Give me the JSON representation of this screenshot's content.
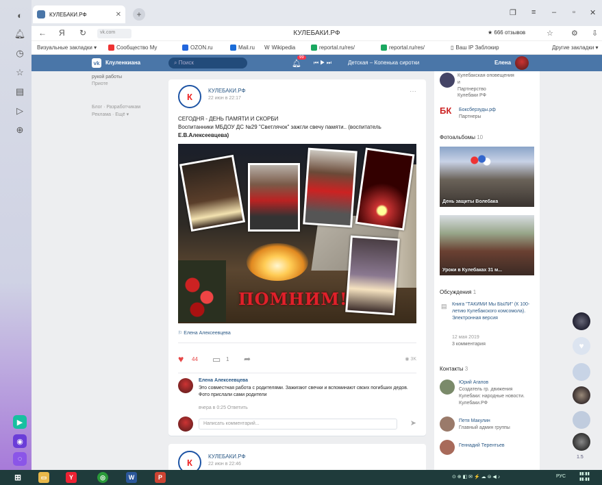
{
  "browser": {
    "tab_title": "КУЛЕБАКИ.РФ",
    "page_title": "КУЛЕБАКИ.РФ",
    "site_chip": "vk.com",
    "reviews_label": "★ 666 отзывов",
    "bookmarks": [
      "Визуальные закладки ▾",
      "Сообщество My",
      "OZON.ru",
      "Mail.ru",
      "Wikipedia",
      "reportal.ru/res/",
      "reportal.ru/res/",
      "Ваш IP Заблокир",
      "Другие закладки ▾"
    ]
  },
  "vk": {
    "app_name": "Клуленкиана",
    "search_placeholder": "Поиск",
    "notif_count": "99",
    "track": "Детская – Копенька сиротки",
    "user_name": "Елена"
  },
  "left": {
    "note_lines": [
      "рукой работы",
      "Приоте"
    ],
    "links": [
      "Блог · Разработчикам",
      "Реклама · Ещё ▾"
    ]
  },
  "post": {
    "author": "КУЛЕБАКИ.РФ",
    "date": "22 июн в 22:17",
    "text_line1": "СЕГОДНЯ - ДЕНЬ ПАМЯТИ И СКОРБИ",
    "text_line2": "Воспитанники МБДОУ ДС №29 \"Светлячок\" зажгли свечу памяти.. (воспитатель",
    "text_line3": "Е.В.Алексеевцева)",
    "photo_caption": "ПОМНИМ!",
    "tag": "⚐ Елена Алексеевцева",
    "likes": "44",
    "comments": "1",
    "views": "◉ 3K"
  },
  "comment": {
    "author": "Елена Алексеевцева",
    "text": "Это совместная работа с родителями. Зажигают свечки и вспоминают своих погибших дедов. Фото прислали сами родители",
    "meta": "вчера в 0:25  Ответить",
    "input_placeholder": "Написать комментарий..."
  },
  "post2": {
    "author": "КУЛЕБАКИ.РФ",
    "date": "22 июн в 22:46"
  },
  "right": {
    "top_text": [
      "Кулебакская оповещения",
      "и",
      "Партнерство",
      "Кулебаки РФ"
    ],
    "partner_name": "Боксберзуды.рф",
    "partner_role": "Партнеры",
    "albums_title": "Фотоальбомы",
    "albums_count": "10",
    "album1": "День защиты Волебака",
    "album2": "Уроки в Кулебаках 31 м...",
    "discussions_title": "Обсуждения",
    "discussions_count": "1",
    "discussion_text": "Книга \"ТАКИМИ Мы БЫЛИ\" (К 100-летию Кулебакского комсомола). Электронная версия",
    "discussion_date": "12 мая 2019",
    "discussion_comments": "3 комментария",
    "contacts_title": "Контакты",
    "contacts_count": "3",
    "contact1_name": "Юрий Агапов",
    "contact1_role": "Создатель гр. движения Кулебаки: народные новости. Кулебаки.РФ",
    "contact2_name": "Петя Макулин",
    "contact2_role": "Главный админ группы",
    "contact3_name": "Геннадий Терентьев"
  },
  "float_count": "1.5"
}
